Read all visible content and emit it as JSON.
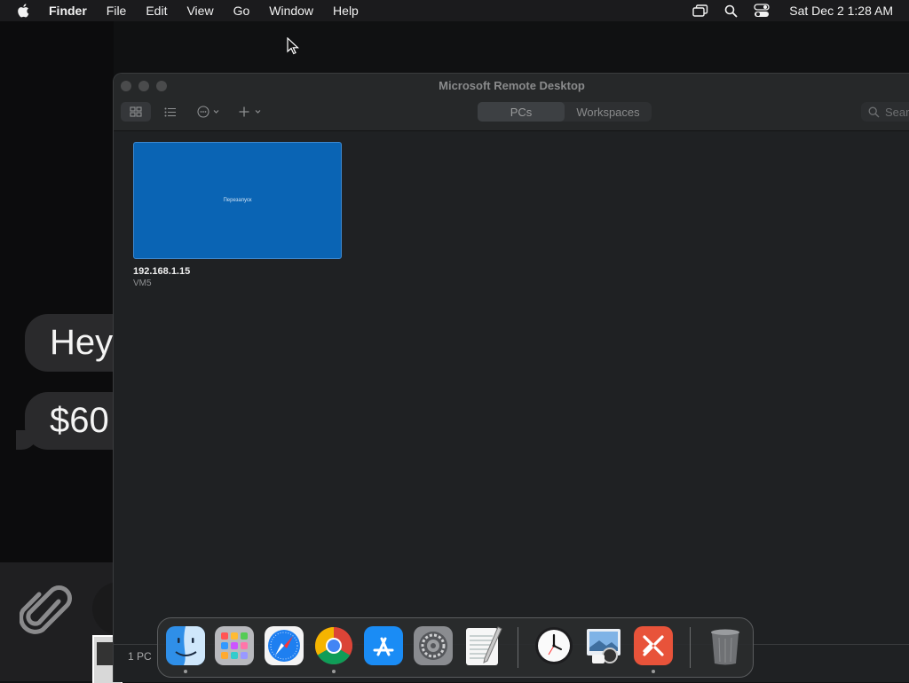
{
  "menubar": {
    "app_name": "Finder",
    "items": [
      "File",
      "Edit",
      "View",
      "Go",
      "Window",
      "Help"
    ],
    "clock": "Sat Dec 2  1:28 AM",
    "status_icons": [
      "screen-mirroring-icon",
      "spotlight-search-icon",
      "control-center-icon"
    ]
  },
  "background_app": {
    "messages": [
      "Hey",
      "$60"
    ],
    "attach_icon": "paperclip-icon"
  },
  "window": {
    "title": "Microsoft Remote Desktop",
    "segments": [
      "PCs",
      "Workspaces"
    ],
    "search_placeholder": "Search",
    "pcs": [
      {
        "name": "192.168.1.15",
        "user": "VM5",
        "thumb_text": "Перезапуск"
      }
    ],
    "status": "1 PC",
    "thumb_color": "#0a64b4"
  },
  "dock": {
    "items": [
      {
        "name": "Finder",
        "icon": "finder-icon",
        "running": true
      },
      {
        "name": "Launchpad",
        "icon": "launchpad-icon",
        "running": false
      },
      {
        "name": "Safari",
        "icon": "safari-icon",
        "running": false
      },
      {
        "name": "Google Chrome",
        "icon": "chrome-icon",
        "running": true
      },
      {
        "name": "App Store",
        "icon": "app-store-icon",
        "running": false
      },
      {
        "name": "System Preferences",
        "icon": "system-preferences-icon",
        "running": false
      },
      {
        "name": "TextEdit",
        "icon": "textedit-icon",
        "running": false
      },
      {
        "name": "Clock",
        "icon": "clock-icon",
        "running": false
      },
      {
        "name": "Preview",
        "icon": "preview-icon",
        "running": false
      },
      {
        "name": "Microsoft Remote Desktop",
        "icon": "remote-desktop-icon",
        "running": true
      },
      {
        "name": "Trash",
        "icon": "trash-icon",
        "running": false
      }
    ]
  }
}
